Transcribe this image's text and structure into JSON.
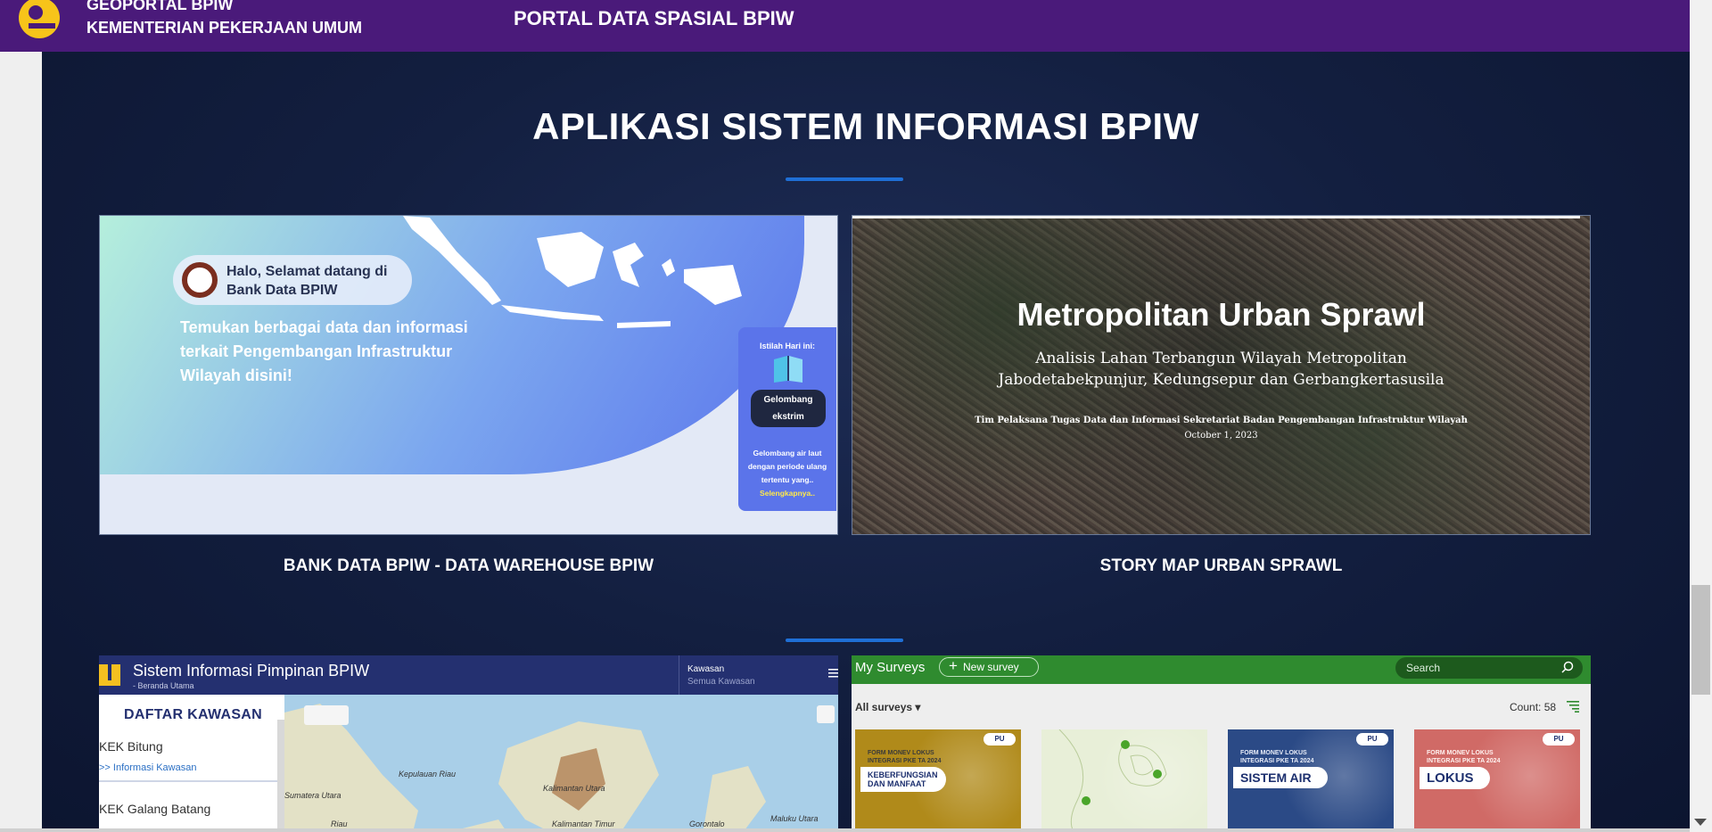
{
  "header": {
    "org_line1": "GEOPORTAL BPIW",
    "org_line2": "KEMENTERIAN PEKERJAAN UMUM",
    "portal_title": "PORTAL DATA SPASIAL BPIW"
  },
  "section": {
    "title": "APLIKASI SISTEM INFORMASI BPIW"
  },
  "cards": {
    "bank": {
      "label": "BANK DATA BPIW - DATA WAREHOUSE BPIW",
      "greeting": "Halo, Selamat datang di Bank Data BPIW",
      "headline": "Temukan berbagai data dan informasi terkait Pengembangan Infrastruktur Wilayah disini!",
      "istilah_head": "Istilah Hari ini:",
      "term": "Gelombang ekstrim",
      "term_desc": "Gelombang air laut dengan periode ulang tertentu yang..",
      "more": "Selengkapnya.."
    },
    "story": {
      "label": "STORY MAP URBAN SPRAWL",
      "title": "Metropolitan Urban Sprawl",
      "subtitle_line1": "Analisis Lahan Terbangun Wilayah Metropolitan",
      "subtitle_line2": "Jabodetabekpunjur, Kedungsepur dan Gerbangkertasusila",
      "credit": "Tim Pelaksana Tugas Data dan Informasi Sekretariat Badan Pengembangan Infrastruktur Wilayah",
      "date": "October 1, 2023"
    },
    "sip": {
      "title": "Sistem Informasi Pimpinan BPIW",
      "subtitle": "- Beranda Utama",
      "kawasan_label": "Kawasan",
      "kawasan_value": "Semua Kawasan",
      "daftar": "DAFTAR KAWASAN",
      "kek1": "KEK Bitung",
      "info1": ">> Informasi Kawasan",
      "kek2": "KEK Galang Batang",
      "map_labels": [
        "Kepulauan Riau",
        "Kalimantan Utara",
        "Sumatera Utara",
        "Kalimantan Timur",
        "Gorontalo",
        "Maluku Utara",
        "Riau"
      ]
    },
    "survey": {
      "title": "My Surveys",
      "new_label": "New survey",
      "search_placeholder": "Search",
      "all_surveys": "All surveys",
      "count": "Count: 58",
      "tile_badge": "PU",
      "tile_small": "FORM MONEV LOKUS INTEGRASI PKE TA 2024",
      "tiles": [
        {
          "label": "KEBERFUNGSIAN DAN MANFAAT",
          "color": "#b08a1a"
        },
        {
          "label": "",
          "color": "#e8efd8"
        },
        {
          "label": "SISTEM AIR",
          "color": "#2b4a86"
        },
        {
          "label": "LOKUS",
          "color": "#d06a66"
        }
      ]
    }
  },
  "colors": {
    "header_bg": "#4a1a7a",
    "accent_divider": "#1f6fd6",
    "survey_green": "#2f8b2f",
    "sip_navy": "#243070"
  }
}
